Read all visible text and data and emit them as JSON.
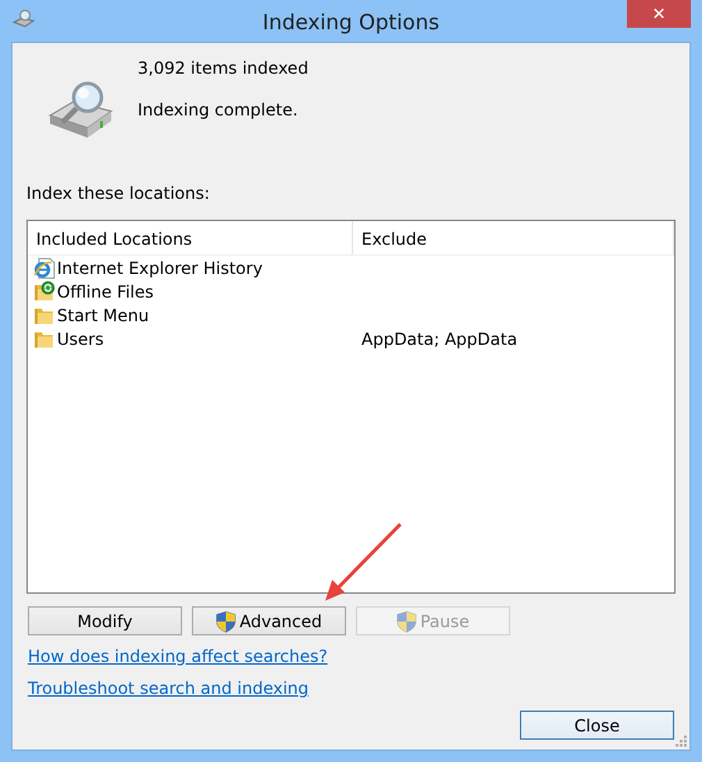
{
  "window": {
    "title": "Indexing Options",
    "close": "✕"
  },
  "status": {
    "count": "3,092 items indexed",
    "message": "Indexing complete."
  },
  "locations": {
    "label": "Index these locations:",
    "columns": [
      "Included Locations",
      "Exclude"
    ],
    "rows": [
      {
        "kind": "ie",
        "name": "Internet Explorer History",
        "exclude": ""
      },
      {
        "kind": "offline",
        "name": "Offline Files",
        "exclude": ""
      },
      {
        "kind": "folder",
        "name": "Start Menu",
        "exclude": ""
      },
      {
        "kind": "folder",
        "name": "Users",
        "exclude": "AppData; AppData"
      }
    ]
  },
  "buttons": [
    {
      "label": "Modify",
      "shield": false,
      "disabled": false
    },
    {
      "label": "Advanced",
      "shield": true,
      "disabled": false
    },
    {
      "label": "Pause",
      "shield": true,
      "disabled": true
    }
  ],
  "links": [
    "How does indexing affect searches?",
    "Troubleshoot search and indexing"
  ],
  "close_button": {
    "label": "Close",
    "default": true
  },
  "annotation": {
    "kind": "arrow"
  }
}
